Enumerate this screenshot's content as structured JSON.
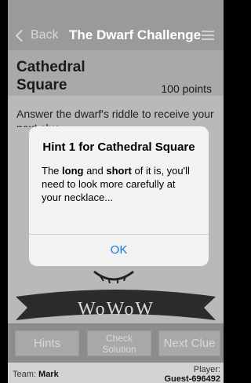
{
  "nav": {
    "back_label": "Back",
    "title": "The Dwarf Challenge"
  },
  "location": {
    "name": "Cathedral Square",
    "points": "100 points"
  },
  "description": "Answer the dwarf's riddle to receive your next clue.",
  "banner_text": "WoWoW",
  "toolbar": {
    "hints_label": "Hints",
    "check_label": "Check Solution",
    "next_label": "Next Clue"
  },
  "footer": {
    "team_prefix": "Team:",
    "team_name": "Mark",
    "player_prefix": "Player:",
    "player_name": "Guest-696492"
  },
  "alert": {
    "title": "Hint 1 for Cathedral Square",
    "message_part1": "The ",
    "message_bold1": "long",
    "message_part2": " and ",
    "message_bold2": "short",
    "message_part3": " of it is, you'll need to look more carefully at your necklace...",
    "ok_label": "OK"
  },
  "colors": {
    "accent": "#1378e6",
    "nav_bg": "#9a9a9a",
    "toolbar_bg": "#8c8c8c"
  }
}
